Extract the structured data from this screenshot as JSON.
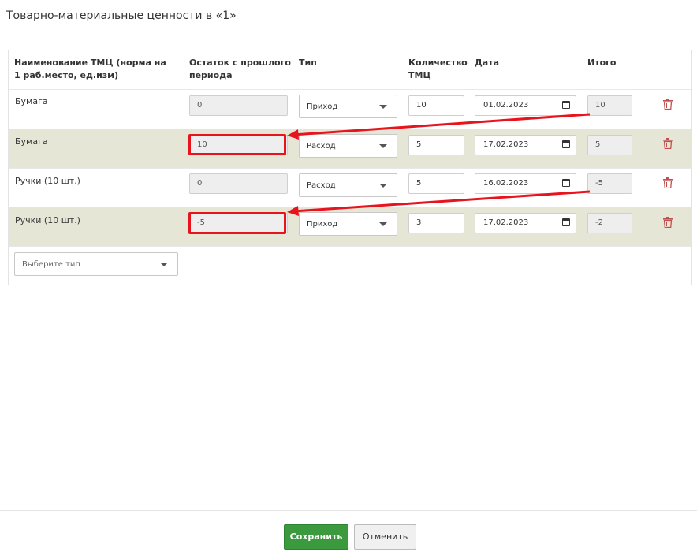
{
  "header": {
    "title": "Товарно-материальные ценности в «1»"
  },
  "table": {
    "columns": {
      "name": "Наименование ТМЦ (норма на 1 раб.место, ед.изм)",
      "remainder": "Остаток с прошлого периода",
      "type": "Тип",
      "quantity": "Количество ТМЦ",
      "date": "Дата",
      "total": "Итого"
    },
    "rows": [
      {
        "name": "Бумага",
        "remainder": "0",
        "type": "Приход",
        "quantity": "10",
        "date": "01.02.2023",
        "total": "10"
      },
      {
        "name": "Бумага",
        "remainder": "10",
        "type": "Расход",
        "quantity": "5",
        "date": "17.02.2023",
        "total": "5"
      },
      {
        "name": "Ручки (10 шт.)",
        "remainder": "0",
        "type": "Расход",
        "quantity": "5",
        "date": "16.02.2023",
        "total": "-5"
      },
      {
        "name": "Ручки (10 шт.)",
        "remainder": "-5",
        "type": "Приход",
        "quantity": "3",
        "date": "17.02.2023",
        "total": "-2"
      }
    ],
    "add_type_placeholder": "Выберите тип"
  },
  "footer": {
    "save_label": "Сохранить",
    "cancel_label": "Отменить"
  },
  "colors": {
    "save": "#3b9a3e",
    "highlight": "#e8141d",
    "row_alt": "#e6e6d6",
    "trash": "#c0504d"
  },
  "icons": {
    "delete": "trash-icon",
    "calendar": "calendar-icon",
    "dropdown": "chevron-down-icon"
  }
}
